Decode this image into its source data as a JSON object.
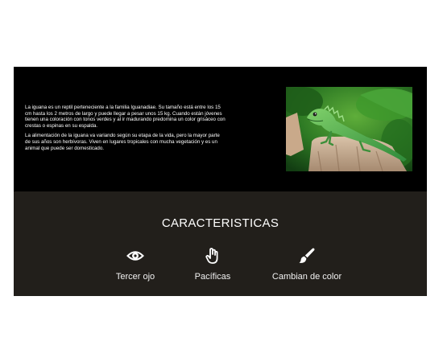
{
  "intro": {
    "paragraph_1": "La iguana es un reptil perteneciente a la familia Iguanadiae. Su tamaño está entre los 15 cm hasta los 2 metros de largo y puede llegar a pesar unos 15 kg. Cuando están jóvenes tienen una coloración con tonos verdes y al ir madurando predomina un color grisáceo con crestas o espinas en su espalda.",
    "paragraph_2": "La alimentación de la iguana va variando según su etapa de la vida, pero la mayor parte de sus años son herbívoras. Viven en lugares tropicales con mucha vegetación y es un animal que puede ser domesticado."
  },
  "features": {
    "title": "CARACTERISTICAS",
    "items": [
      {
        "label": "Tercer ojo",
        "icon": "eye-icon"
      },
      {
        "label": "Pacíficas",
        "icon": "hand-icon"
      },
      {
        "label": "Cambian de color",
        "icon": "paintbrush-icon"
      }
    ]
  },
  "colors": {
    "intro_background": "#000000",
    "features_background": "#221f1b",
    "text": "#ffffff"
  }
}
